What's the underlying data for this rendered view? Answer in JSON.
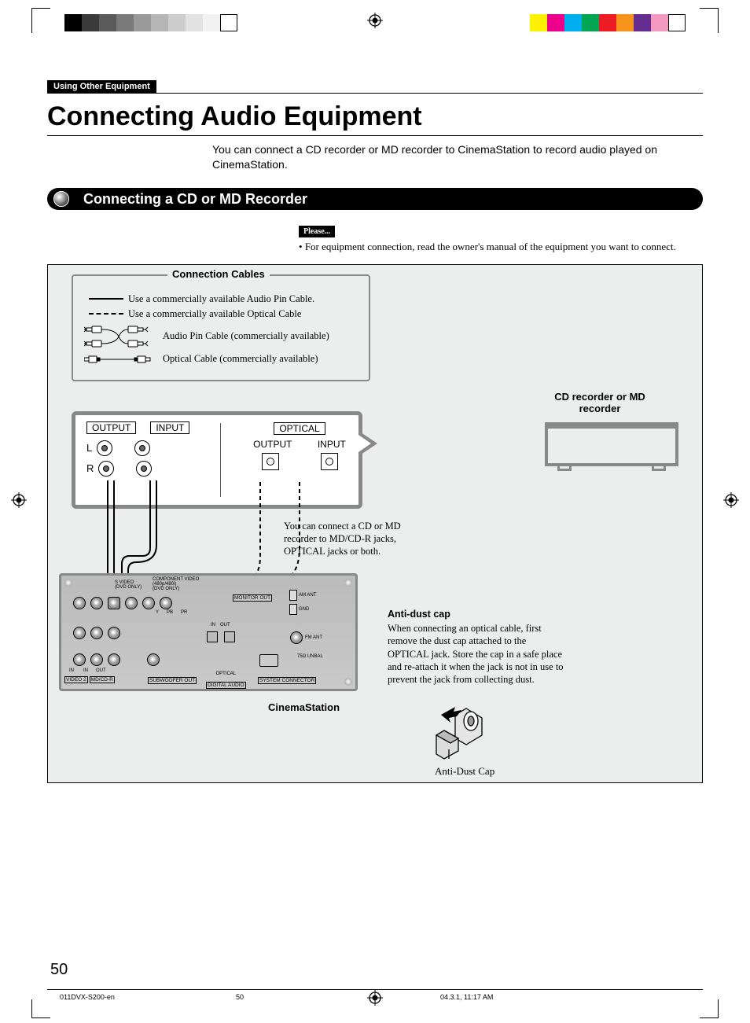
{
  "printer_colors_left": [
    "#000000",
    "#3a3a3a",
    "#5a5a5a",
    "#7a7a7a",
    "#9a9a9a",
    "#b5b5b5",
    "#cdcdcd",
    "#e2e2e2",
    "#f2f2f2",
    "#ffffff"
  ],
  "printer_colors_right": [
    "#fff200",
    "#ec008c",
    "#00aeef",
    "#00a651",
    "#ed1c24",
    "#f7941d",
    "#662d91",
    "#f49ac1",
    "#ffffff"
  ],
  "section_tag": "Using Other Equipment",
  "title": "Connecting Audio Equipment",
  "intro": "You can connect a CD recorder or MD recorder to CinemaStation to record audio played on CinemaStation.",
  "subhead": "Connecting a CD or MD Recorder",
  "please_label": "Please...",
  "please_items": [
    "For equipment connection, read the owner's manual of the equipment you want to connect."
  ],
  "cables": {
    "legend": "Connection Cables",
    "solid_text": "Use a commercially available Audio Pin Cable.",
    "dash_text": "Use a commercially available Optical Cable",
    "pair_text": "Audio Pin Cable (commercially available)",
    "opt_text": "Optical Cable (commercially available)"
  },
  "recorder_caption": "CD recorder or MD recorder",
  "callout": {
    "output": "OUTPUT",
    "input": "INPUT",
    "optical": "OPTICAL",
    "l": "L",
    "r": "R"
  },
  "note": "You can connect a CD or MD recorder to MD/CD-R jacks, OPTICAL jacks or both.",
  "rear": {
    "svideo": "S VIDEO",
    "dvd_only": "(DVD ONLY)",
    "component": "COMPONENT VIDEO",
    "res": "(480p/480i)",
    "y": "Y",
    "pb": "PB",
    "pr": "PR",
    "monitor": "MONITOR OUT",
    "am": "AM ANT",
    "gnd": "GND",
    "fm": "FM ANT",
    "ohm": "75Ω UNBAL",
    "in": "IN",
    "out": "OUT",
    "video2": "VIDEO 2",
    "mdcdr": "MD/CD-R",
    "sub": "SUBWOOFER OUT",
    "optical": "OPTICAL",
    "digital": "DIGITAL AUDIO",
    "sysconn": "SYSTEM CONNECTOR"
  },
  "cinema": "CinemaStation",
  "anti": {
    "heading": "Anti-dust cap",
    "body": "When connecting an optical cable, first remove the dust cap attached to the OPTICAL jack. Store the cap in a safe place and re-attach it when the jack is not in use to prevent the jack from collecting dust.",
    "caption": "Anti-Dust Cap"
  },
  "page_number": "50",
  "footer_file": "011DVX-S200-en",
  "footer_page": "50",
  "footer_time": "04.3.1, 11:17 AM"
}
